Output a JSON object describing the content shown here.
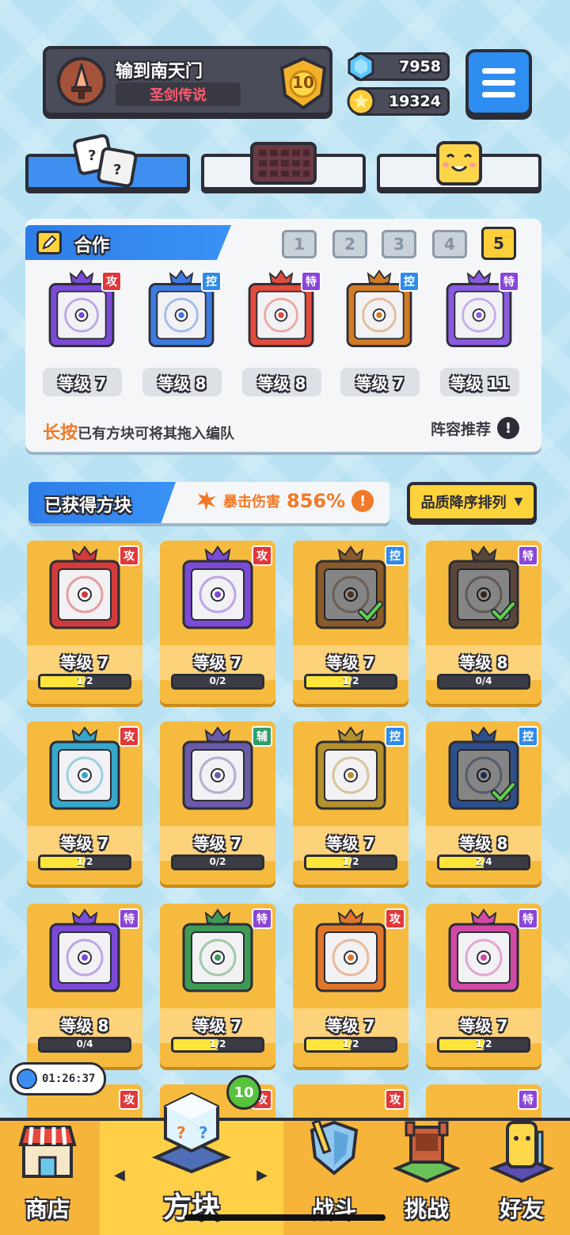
{
  "player": {
    "name": "输到南天门",
    "title": "圣剑传说",
    "rank": "10"
  },
  "currencies": {
    "gems": "7958",
    "coins": "19324"
  },
  "team": {
    "header": "合作",
    "slots": [
      "1",
      "2",
      "3",
      "4",
      "5"
    ],
    "active_slot": 5,
    "members": [
      {
        "tag": "攻",
        "tag_color": "#e2383b",
        "frame": "#7b4ad6",
        "level": "等级 7"
      },
      {
        "tag": "控",
        "tag_color": "#2f8be9",
        "frame": "#3d7be0",
        "level": "等级 8"
      },
      {
        "tag": "特",
        "tag_color": "#8a46d8",
        "frame": "#e24c3c",
        "level": "等级 8"
      },
      {
        "tag": "控",
        "tag_color": "#2f8be9",
        "frame": "#d27b25",
        "level": "等级 7"
      },
      {
        "tag": "特",
        "tag_color": "#8a46d8",
        "frame": "#8a5be0",
        "level": "等级 11"
      }
    ],
    "hint_highlight": "长按",
    "hint_text": "已有方块可将其拖入编队",
    "recommend": "阵容推荐"
  },
  "acquired": {
    "title": "已获得方块",
    "crit_label": "暴击伤害",
    "crit_value": "856%",
    "sort_label": "品质降序排列"
  },
  "blocks": [
    {
      "tag": "攻",
      "tag_color": "#e2383b",
      "frame": "#d33a3a",
      "level": "等级 7",
      "progress": "1/2",
      "fraction": 0.5,
      "owned": false
    },
    {
      "tag": "攻",
      "tag_color": "#e2383b",
      "frame": "#7b4ad6",
      "level": "等级 7",
      "progress": "0/2",
      "fraction": 0,
      "owned": false
    },
    {
      "tag": "控",
      "tag_color": "#2f8be9",
      "frame": "#8a5a2a",
      "level": "等级 7",
      "progress": "1/2",
      "fraction": 0.5,
      "owned": true
    },
    {
      "tag": "特",
      "tag_color": "#8a46d8",
      "frame": "#5a4638",
      "level": "等级 8",
      "progress": "0/4",
      "fraction": 0,
      "owned": true
    },
    {
      "tag": "攻",
      "tag_color": "#e2383b",
      "frame": "#38a7c9",
      "level": "等级 7",
      "progress": "1/2",
      "fraction": 0.5,
      "owned": false
    },
    {
      "tag": "辅",
      "tag_color": "#2f9f6a",
      "frame": "#6a5aa8",
      "level": "等级 7",
      "progress": "0/2",
      "fraction": 0,
      "owned": false
    },
    {
      "tag": "控",
      "tag_color": "#2f8be9",
      "frame": "#b4912e",
      "level": "等级 7",
      "progress": "1/2",
      "fraction": 0.5,
      "owned": false
    },
    {
      "tag": "控",
      "tag_color": "#2f8be9",
      "frame": "#2d4f8a",
      "level": "等级 8",
      "progress": "2/4",
      "fraction": 0.5,
      "owned": true
    },
    {
      "tag": "特",
      "tag_color": "#8a46d8",
      "frame": "#7b4ad6",
      "level": "等级 8",
      "progress": "0/4",
      "fraction": 0,
      "owned": false
    },
    {
      "tag": "特",
      "tag_color": "#8a46d8",
      "frame": "#3e9a55",
      "level": "等级 7",
      "progress": "1/2",
      "fraction": 0.5,
      "owned": false
    },
    {
      "tag": "攻",
      "tag_color": "#e2383b",
      "frame": "#e0762a",
      "level": "等级 7",
      "progress": "1/2",
      "fraction": 0.5,
      "owned": false
    },
    {
      "tag": "特",
      "tag_color": "#8a46d8",
      "frame": "#d24aa6",
      "level": "等级 7",
      "progress": "1/2",
      "fraction": 0.5,
      "owned": false
    }
  ],
  "partial_row_tags": [
    {
      "tag": "攻",
      "tag_color": "#e2383b"
    },
    {
      "tag": "攻",
      "tag_color": "#e2383b"
    },
    {
      "tag": "攻",
      "tag_color": "#e2383b"
    },
    {
      "tag": "特",
      "tag_color": "#8a46d8"
    }
  ],
  "timer": "01:26:37",
  "nav": {
    "shop": "商店",
    "blocks": "方块",
    "battle": "战斗",
    "challenge": "挑战",
    "friends": "好友",
    "blocks_badge": "10"
  },
  "colors": {
    "accent_blue": "#3f8ff0",
    "gold": "#f6bb3e",
    "dark": "#2c2d36"
  }
}
